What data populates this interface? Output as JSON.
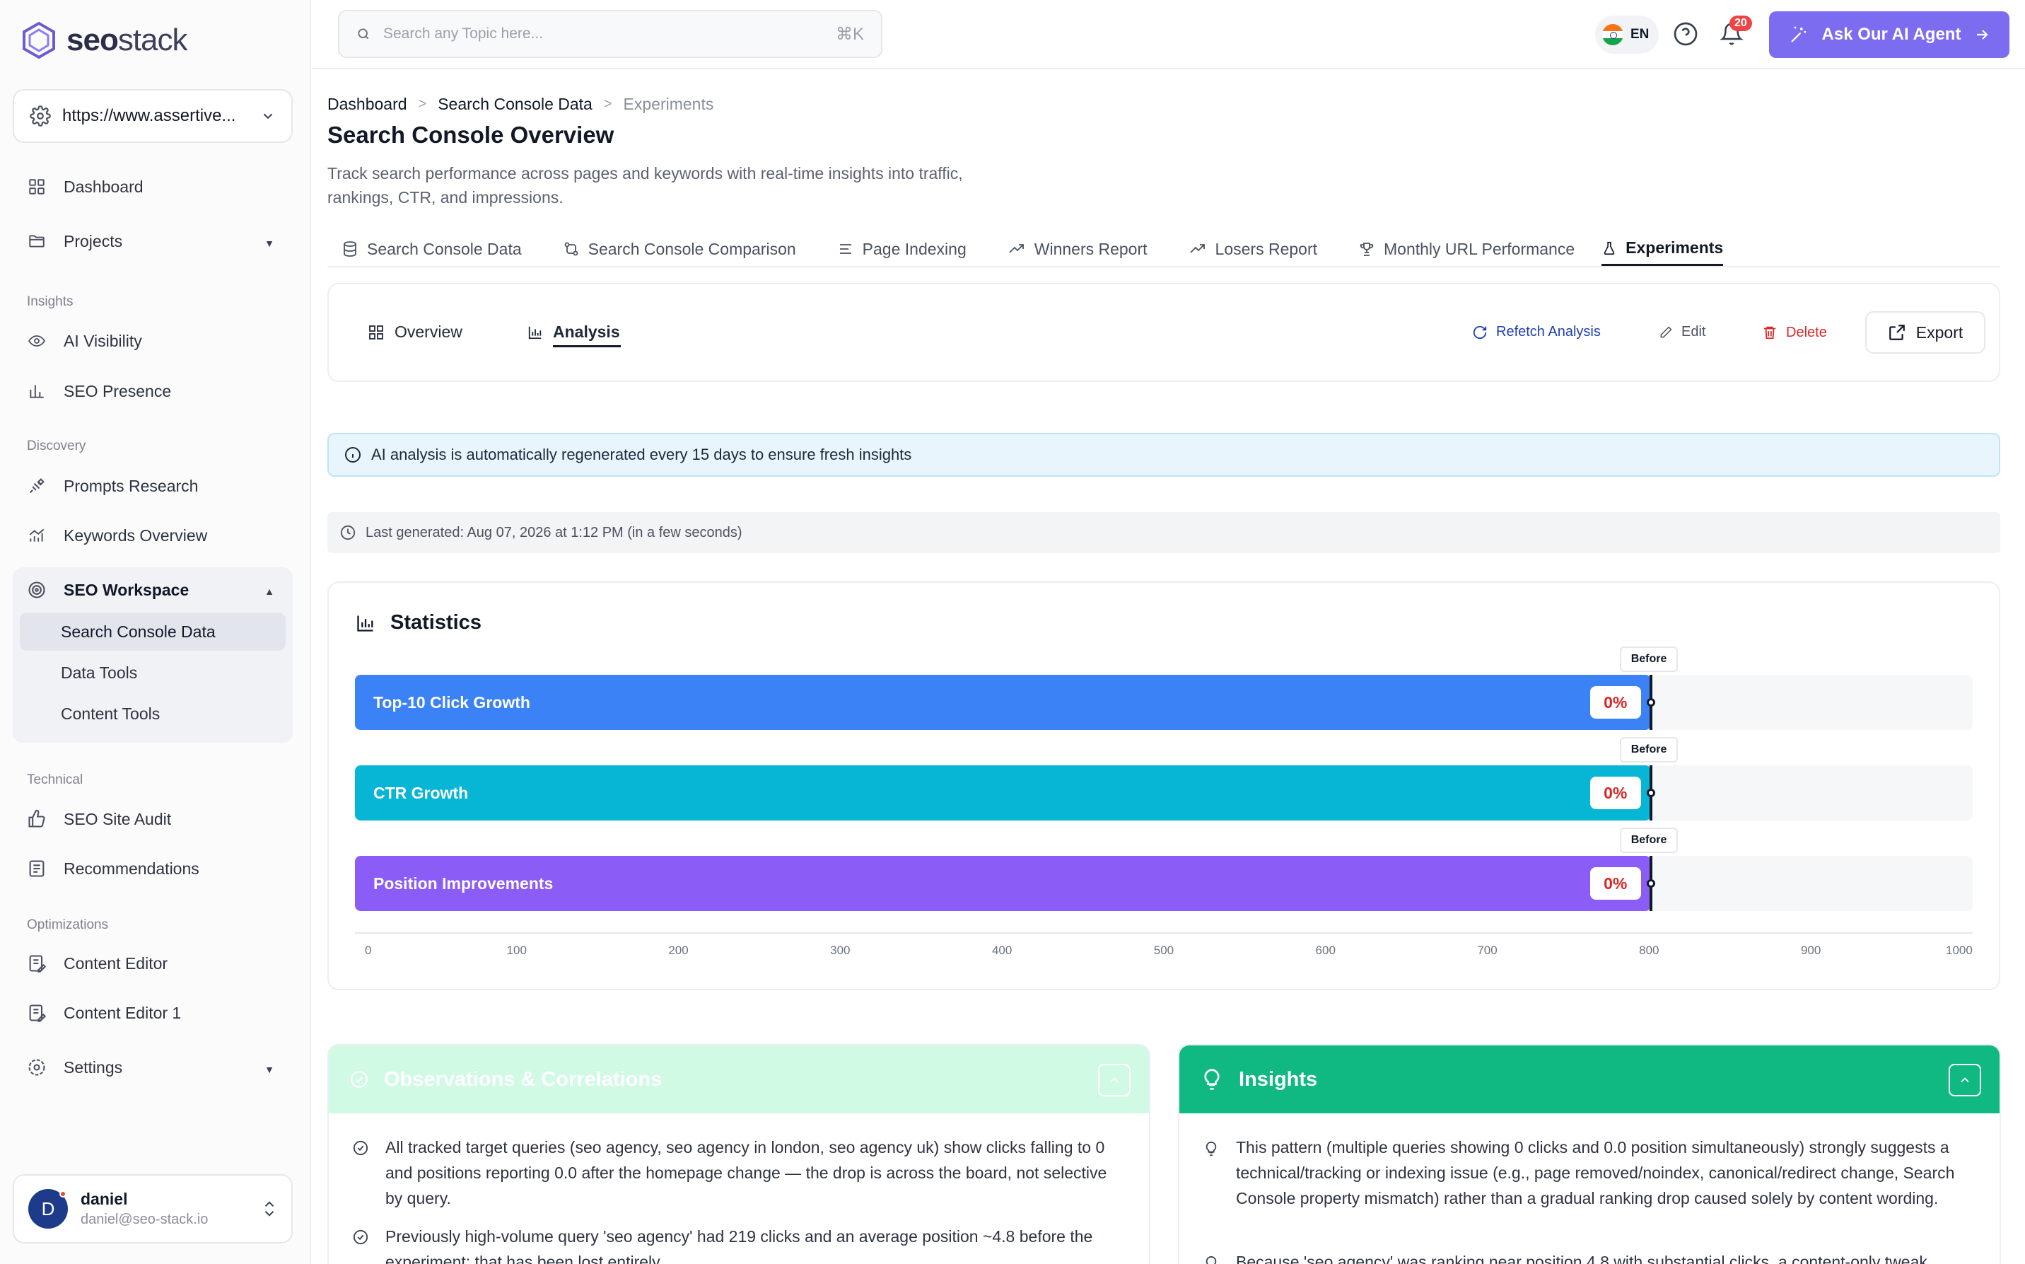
{
  "app": {
    "logo_text_bold": "seo",
    "logo_text": "stack"
  },
  "sidebar": {
    "site_url": "https://www.assertive...",
    "items": {
      "dashboard": "Dashboard",
      "projects": "Projects",
      "ai_visibility": "AI Visibility",
      "seo_presence": "SEO Presence",
      "prompts_research": "Prompts Research",
      "keywords_overview": "Keywords Overview",
      "seo_workspace": "SEO Workspace",
      "search_console_data": "Search Console Data",
      "data_tools": "Data Tools",
      "content_tools": "Content Tools",
      "seo_site_audit": "SEO Site Audit",
      "recommendations": "Recommendations",
      "content_editor": "Content Editor",
      "content_editor_1": "Content Editor 1",
      "settings": "Settings"
    },
    "sections": {
      "insights": "Insights",
      "discovery": "Discovery",
      "technical": "Technical",
      "optimizations": "Optimizations"
    },
    "user": {
      "initial": "D",
      "name": "daniel",
      "email": "daniel@seo-stack.io"
    }
  },
  "topbar": {
    "search_placeholder": "Search any Topic here...",
    "shortcut": "⌘K",
    "language": "EN",
    "notification_count": "20",
    "ai_agent_label": "Ask Our AI Agent"
  },
  "breadcrumb": {
    "level1": "Dashboard",
    "level2": "Search Console Data",
    "level3": "Experiments"
  },
  "page": {
    "title": "Search Console Overview",
    "description": "Track search performance across pages and keywords with real-time insights into traffic, rankings, CTR, and impressions."
  },
  "tabs": {
    "search_console_data": "Search Console Data",
    "search_console_comparison": "Search Console Comparison",
    "page_indexing": "Page Indexing",
    "winners_report": "Winners Report",
    "losers_report": "Losers Report",
    "monthly_url_performance": "Monthly URL Performance",
    "experiments": "Experiments"
  },
  "experiment": {
    "subtab_overview": "Overview",
    "subtab_analysis": "Analysis",
    "refetch_label": "Refetch Analysis",
    "edit_label": "Edit",
    "delete_label": "Delete",
    "export_label": "Export",
    "info_banner": "AI analysis is automatically regenerated every 15 days to ensure fresh insights",
    "last_generated": "Last generated: Aug 07, 2026 at 1:12 PM (in a few seconds)"
  },
  "statistics": {
    "title": "Statistics",
    "marker_label": "Before"
  },
  "chart_data": {
    "type": "bar",
    "orientation": "horizontal",
    "categories": [
      "Top-10 Click Growth",
      "CTR Growth",
      "Position Improvements"
    ],
    "values": [
      801,
      801,
      801
    ],
    "data_labels": [
      "0%",
      "0%",
      "0%"
    ],
    "marker_value": 801,
    "marker_label": "Before",
    "xlim": [
      0,
      1000
    ],
    "xticks": [
      0,
      100,
      200,
      300,
      400,
      500,
      600,
      700,
      800,
      900,
      1000
    ],
    "colors": [
      "#3b82f6",
      "#06b6d4",
      "#8b5cf6"
    ]
  },
  "observations": {
    "title": "Observations & Correlations",
    "items": [
      "All tracked target queries (seo agency, seo agency in london, seo agency uk) show clicks falling to 0 and positions reporting 0.0 after the homepage change — the drop is across the board, not selective by query.",
      "Previously high-volume query 'seo agency' had 219 clicks and an average position ~4.8 before the experiment; that has been lost entirely."
    ]
  },
  "insights": {
    "title": "Insights",
    "items": [
      "This pattern (multiple queries showing 0 clicks and 0.0 position simultaneously) strongly suggests a technical/tracking or indexing issue (e.g., page removed/noindex, canonical/redirect change, Search Console property mismatch) rather than a gradual ranking drop caused solely by content wording.",
      "Because 'seo agency' was ranking near position 4.8 with substantial clicks, a content-only tweak"
    ]
  },
  "colors": {
    "accent": "#7c6cf0",
    "observations_header": "#d1fae5",
    "insights_header": "#10b981",
    "danger": "#dc2626",
    "link": "#1e40af"
  }
}
